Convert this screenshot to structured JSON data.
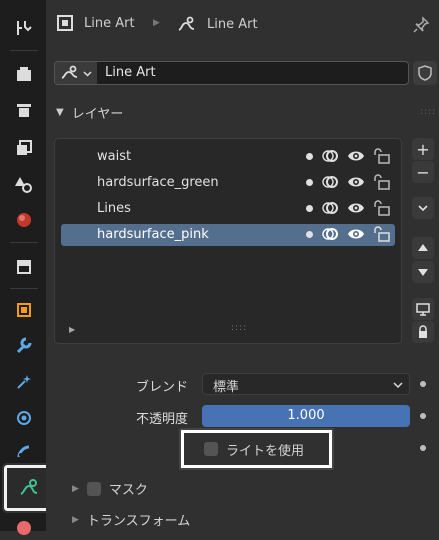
{
  "header": {
    "object_name": "Line Art",
    "data_name": "Line Art",
    "pin_icon": "pin-icon"
  },
  "data_selector": {
    "value": "Line Art"
  },
  "layers_panel": {
    "title": "レイヤー",
    "layers": [
      {
        "name": "waist"
      },
      {
        "name": "hardsurface_green"
      },
      {
        "name": "Lines"
      },
      {
        "name": "hardsurface_pink"
      }
    ],
    "selected_index": 3,
    "grip": "::::"
  },
  "props": {
    "blend_label": "ブレンド",
    "blend_value": "標準",
    "opacity_label": "不透明度",
    "opacity_value": "1.000",
    "use_lights_label": "ライトを使用"
  },
  "subpanels": {
    "mask_label": "マスク",
    "transform_label": "トランスフォーム"
  },
  "colors": {
    "accent_selected": "#546e8e",
    "slider": "#4772b3",
    "active_tab_icon": "#3ec28f"
  }
}
